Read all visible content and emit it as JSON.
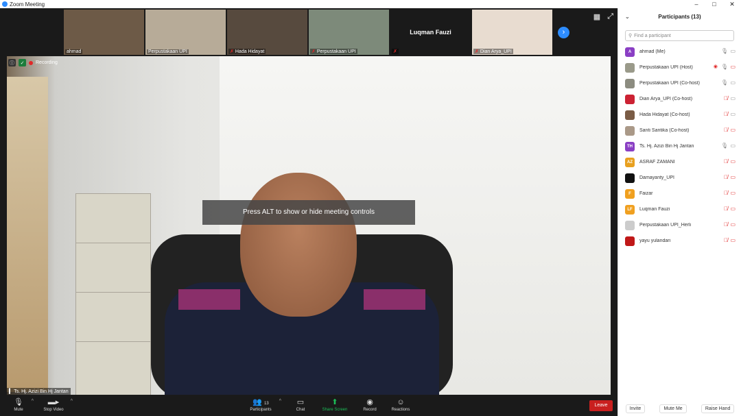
{
  "window": {
    "title": "Zoom Meeting",
    "controls": [
      "–",
      "□",
      "✕"
    ]
  },
  "thumbnails": [
    {
      "name": "ahmad",
      "muted": false,
      "bg": "#6d5a47"
    },
    {
      "name": "Perpustakaan UPI",
      "muted": false,
      "bg": "#b7ab98"
    },
    {
      "name": "Hada Hidayat",
      "muted": true,
      "bg": "#574a3e"
    },
    {
      "name": "Perpustakaan UPI",
      "muted": true,
      "bg": "#7d8a7a"
    },
    {
      "name": "Luqman Fauzi",
      "muted": true,
      "bg": "#1a1a1a",
      "text_only": true
    },
    {
      "name": "Dian Arya_UPI",
      "muted": true,
      "bg": "#e8dcd0"
    }
  ],
  "hint": "Press ALT to show or hide meeting controls",
  "recording": "Recording",
  "main_speaker_label": "Ts. Hj. Azizi Bin Hj Jantan",
  "toolbar": {
    "mute": "Mute",
    "stop_video": "Stop Video",
    "participants": "Participants",
    "participants_count": "13",
    "chat": "Chat",
    "share": "Share Screen",
    "record": "Record",
    "reactions": "Reactions",
    "leave": "Leave"
  },
  "panel": {
    "title": "Participants (13)",
    "search_placeholder": "Find a participant",
    "participants": [
      {
        "name": "ahmad (Me)",
        "initials": "A",
        "color": "#8a3fc4",
        "mic": "on",
        "cam": "on"
      },
      {
        "name": "Perpustakaan UPI (Host)",
        "initials": "",
        "color": "#9a9a8a",
        "mic": "rec",
        "cam": "off",
        "rec": true
      },
      {
        "name": "Perpustakaan UPI (Co-host)",
        "initials": "",
        "color": "#8c8c80",
        "mic": "on",
        "cam": "on"
      },
      {
        "name": "Dian Arya_UPI (Co-host)",
        "initials": "",
        "color": "#c23",
        "mic": "off",
        "cam": "on"
      },
      {
        "name": "Hada Hidayat (Co-host)",
        "initials": "",
        "color": "#7a5c45",
        "mic": "off",
        "cam": "on"
      },
      {
        "name": "Santi Santika (Co-host)",
        "initials": "",
        "color": "#aa9988",
        "mic": "off",
        "cam": "off"
      },
      {
        "name": "Ts. Hj. Azizi Bin Hj Jantan",
        "initials": "TH",
        "color": "#8a3fc4",
        "mic": "on",
        "cam": "on"
      },
      {
        "name": "ASRAF ZAMANI",
        "initials": "AZ",
        "color": "#e8a020",
        "mic": "off",
        "cam": "off"
      },
      {
        "name": "Damayanty_UPI",
        "initials": "",
        "color": "#111",
        "mic": "off",
        "cam": "off"
      },
      {
        "name": "Faizar",
        "initials": "F",
        "color": "#f0a020",
        "mic": "off",
        "cam": "off"
      },
      {
        "name": "Luqman Fauzi",
        "initials": "LF",
        "color": "#f0a020",
        "mic": "off",
        "cam": "off"
      },
      {
        "name": "Perpustakaan UPI_Herli",
        "initials": "",
        "color": "#ccc",
        "mic": "off",
        "cam": "off"
      },
      {
        "name": "yayu yulandari",
        "initials": "",
        "color": "#c01818",
        "mic": "off",
        "cam": "off"
      }
    ],
    "footer": {
      "invite": "Invite",
      "mute_me": "Mute Me",
      "raise_hand": "Raise Hand"
    }
  }
}
